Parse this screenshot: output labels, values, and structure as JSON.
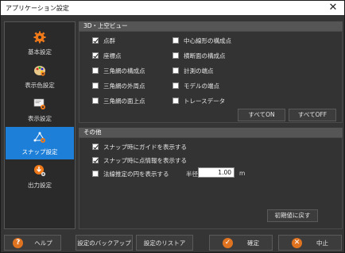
{
  "window": {
    "title": "アプリケーション設定",
    "close_glyph": "✕"
  },
  "sidebar": {
    "items": [
      {
        "label": "基本設定",
        "icon": "gear-icon"
      },
      {
        "label": "表示色設定",
        "icon": "palette-icon"
      },
      {
        "label": "表示設定",
        "icon": "display-settings-icon"
      },
      {
        "label": "スナップ設定",
        "icon": "snap-icon",
        "active": true
      },
      {
        "label": "出力設定",
        "icon": "output-icon"
      }
    ]
  },
  "section_3d": {
    "header": "3D・上空ビュー",
    "left_options": [
      {
        "label": "点群",
        "checked": true
      },
      {
        "label": "座標点",
        "checked": true
      },
      {
        "label": "三角網の構成点",
        "checked": false
      },
      {
        "label": "三角網の外周点",
        "checked": false
      },
      {
        "label": "三角網の面上点",
        "checked": false
      }
    ],
    "right_options": [
      {
        "label": "中心線形の構成点",
        "checked": false
      },
      {
        "label": "横断面の構成点",
        "checked": false
      },
      {
        "label": "計測の端点",
        "checked": false
      },
      {
        "label": "モデルの端点",
        "checked": false
      },
      {
        "label": "トレースデータ",
        "checked": false
      }
    ],
    "all_on_label": "すべてON",
    "all_off_label": "すべてOFF"
  },
  "section_other": {
    "header": "その他",
    "options": [
      {
        "label": "スナップ時にガイドを表示する",
        "checked": true
      },
      {
        "label": "スナップ時に点情報を表示する",
        "checked": true
      },
      {
        "label": "法線推定の円を表示する",
        "checked": false
      }
    ],
    "radius_label": "半径",
    "radius_value": "1.00",
    "radius_unit": "m",
    "reset_label": "初期値に戻す"
  },
  "footer": {
    "help_label": "ヘルプ",
    "backup_label": "設定のバックアップ",
    "restore_label": "設定のリストア",
    "ok_label": "確定",
    "cancel_label": "中止"
  },
  "colors": {
    "accent": "#1e7fd8",
    "help": "#e0731f",
    "ok": "#e0731f",
    "cancel": "#e0731f"
  }
}
